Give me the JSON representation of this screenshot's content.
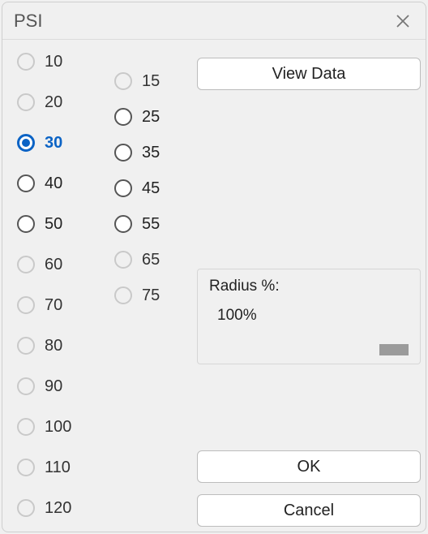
{
  "dialog": {
    "title": "PSI",
    "close_label": "Close"
  },
  "col1": {
    "options": [
      {
        "label": "10",
        "state": "dim"
      },
      {
        "label": "20",
        "state": "dim"
      },
      {
        "label": "30",
        "state": "selected"
      },
      {
        "label": "40",
        "state": "normal"
      },
      {
        "label": "50",
        "state": "normal"
      },
      {
        "label": "60",
        "state": "dim"
      },
      {
        "label": "70",
        "state": "dim"
      },
      {
        "label": "80",
        "state": "dim"
      },
      {
        "label": "90",
        "state": "dim"
      },
      {
        "label": "100",
        "state": "dim"
      },
      {
        "label": "110",
        "state": "dim"
      },
      {
        "label": "120",
        "state": "dim"
      }
    ]
  },
  "col2": {
    "options": [
      {
        "label": "15",
        "state": "dim"
      },
      {
        "label": "25",
        "state": "normal"
      },
      {
        "label": "35",
        "state": "normal"
      },
      {
        "label": "45",
        "state": "normal"
      },
      {
        "label": "55",
        "state": "normal"
      },
      {
        "label": "65",
        "state": "dim"
      },
      {
        "label": "75",
        "state": "dim"
      }
    ]
  },
  "buttons": {
    "view_data": "View Data",
    "ok": "OK",
    "cancel": "Cancel"
  },
  "panel": {
    "label": "Radius %:",
    "value": "100%"
  }
}
